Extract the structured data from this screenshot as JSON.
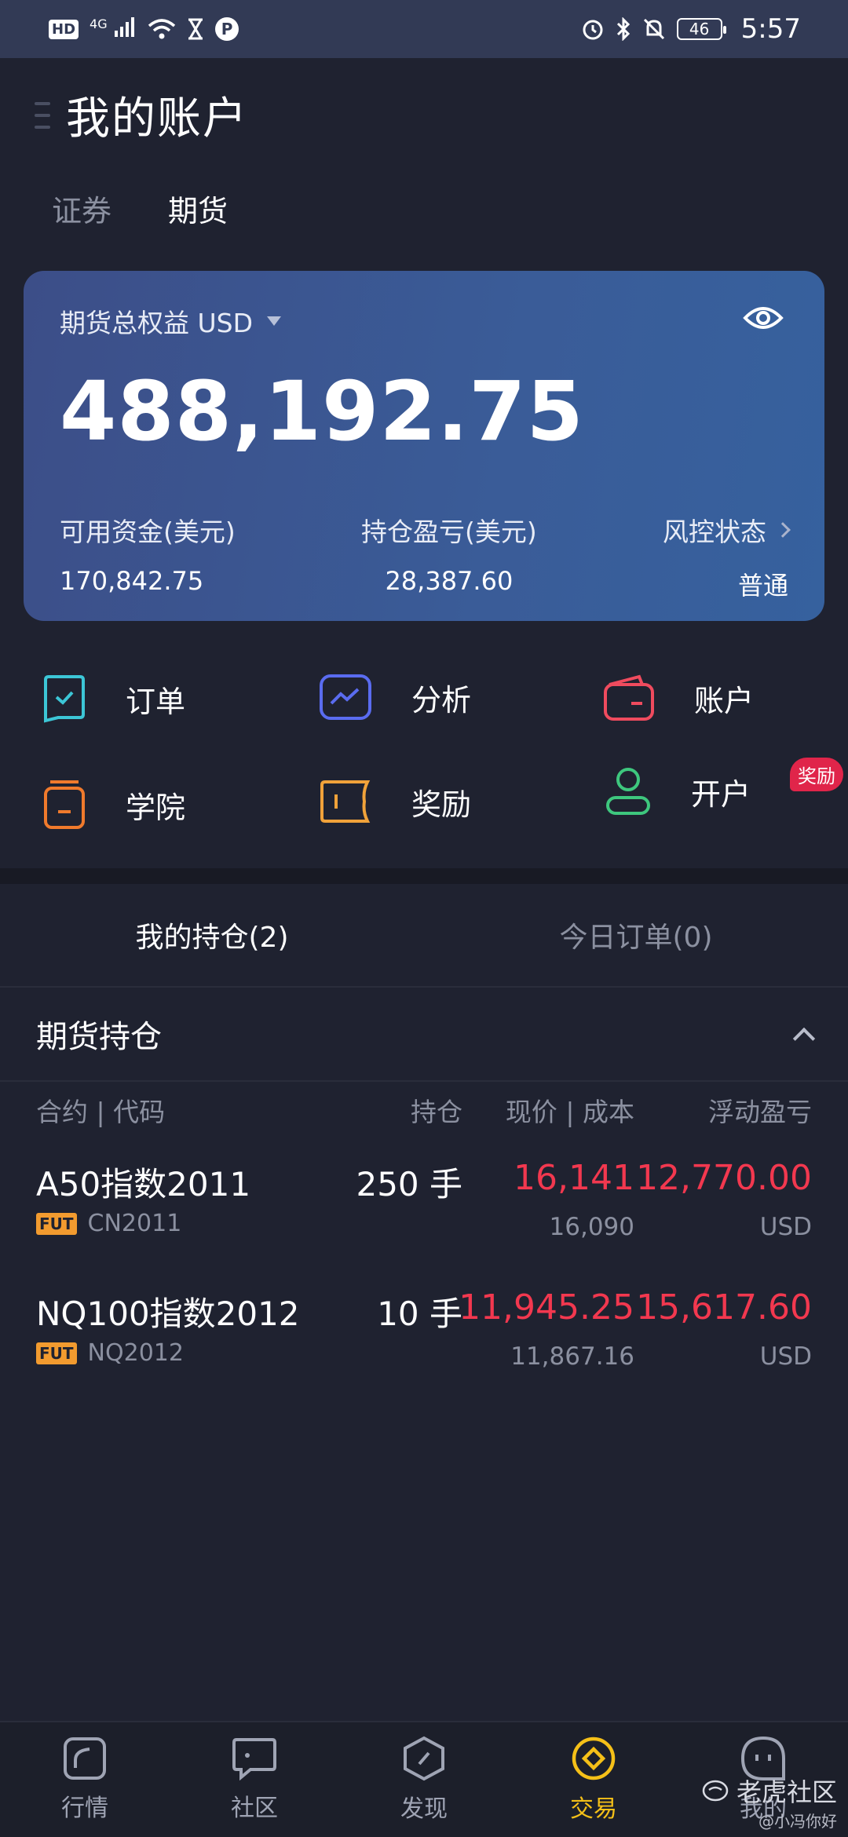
{
  "status_bar": {
    "hd": "HD",
    "network": "4G",
    "battery": "46",
    "time": "5:57"
  },
  "header": {
    "title": "我的账户"
  },
  "top_tabs": [
    {
      "label": "证券",
      "active": false
    },
    {
      "label": "期货",
      "active": true
    }
  ],
  "equity": {
    "label": "期货总权益 USD",
    "total": "488,192.75",
    "available_label": "可用资金(美元)",
    "available_value": "170,842.75",
    "position_pnl_label": "持仓盈亏(美元)",
    "position_pnl_value": "28,387.60",
    "risk_label": "风控状态",
    "risk_value": "普通"
  },
  "actions": {
    "orders": "订单",
    "analysis": "分析",
    "account": "账户",
    "academy": "学院",
    "rewards": "奖励",
    "open_account": "开户",
    "reward_badge": "奖励"
  },
  "holding_tabs": [
    {
      "label": "我的持仓(2)",
      "active": true
    },
    {
      "label": "今日订单(0)",
      "active": false
    }
  ],
  "section": {
    "title": "期货持仓"
  },
  "columns": {
    "contract": "合约 | 代码",
    "position": "持仓",
    "price": "现价 | 成本",
    "pnl": "浮动盈亏"
  },
  "rows": [
    {
      "name": "A50指数2011",
      "tag": "FUT",
      "code": "CN2011",
      "qty": "250 手",
      "price": "16,141",
      "cost": "16,090",
      "pnl": "12,770.00",
      "currency": "USD"
    },
    {
      "name": "NQ100指数2012",
      "tag": "FUT",
      "code": "NQ2012",
      "qty": "10 手",
      "price": "11,945.25",
      "cost": "11,867.16",
      "pnl": "15,617.60",
      "currency": "USD"
    }
  ],
  "bottom_nav": [
    {
      "label": "行情",
      "icon": "market-icon",
      "active": false
    },
    {
      "label": "社区",
      "icon": "community-icon",
      "active": false
    },
    {
      "label": "发现",
      "icon": "discover-icon",
      "active": false
    },
    {
      "label": "交易",
      "icon": "trade-icon",
      "active": true
    },
    {
      "label": "我的",
      "icon": "profile-icon",
      "active": false
    }
  ],
  "watermark": {
    "main": "老虎社区",
    "sub": "@小冯你好"
  },
  "colors": {
    "background": "#1f2230",
    "card": "#3a5c98",
    "profit_red": "#f2384f",
    "nav_active": "#f5c018"
  }
}
